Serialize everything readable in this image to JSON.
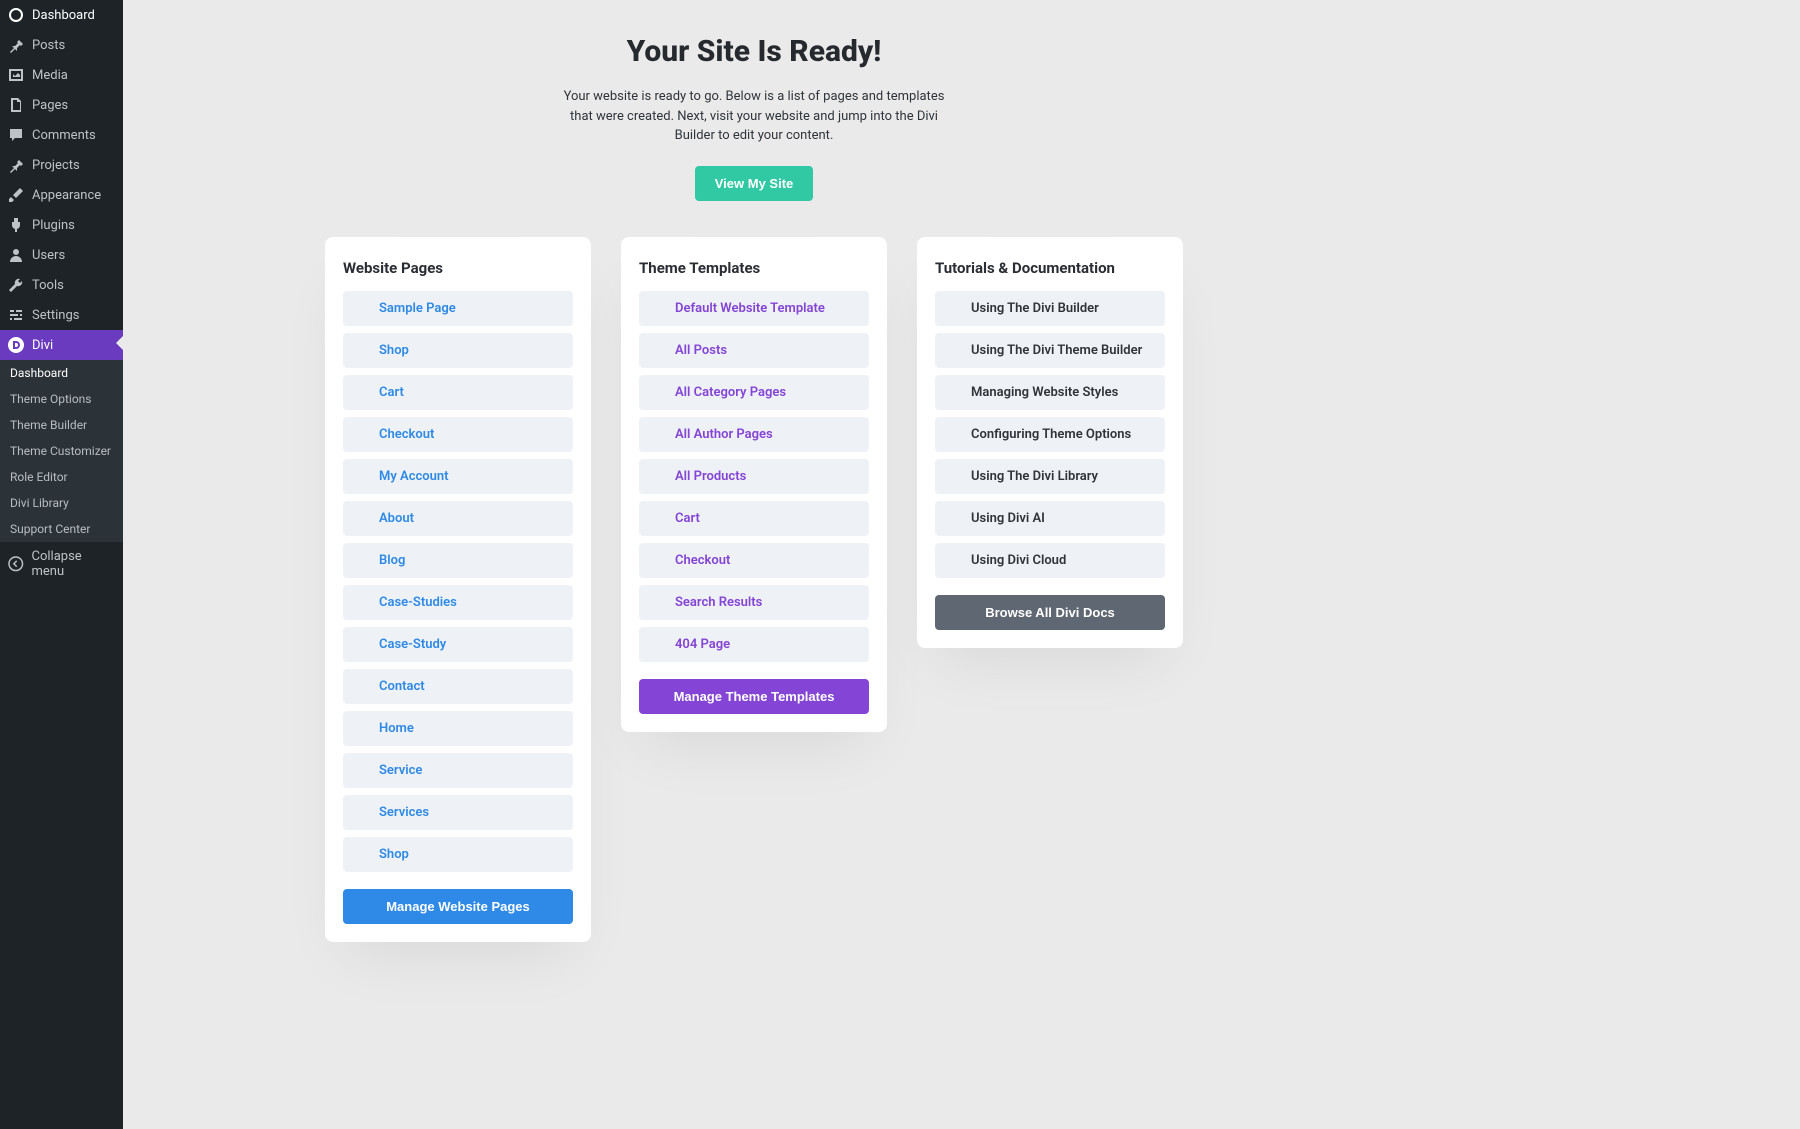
{
  "sidebar": {
    "items": [
      {
        "name": "dashboard",
        "label": "Dashboard",
        "icon": "gauge"
      },
      {
        "name": "posts",
        "label": "Posts",
        "icon": "pin"
      },
      {
        "name": "media",
        "label": "Media",
        "icon": "media"
      },
      {
        "name": "pages",
        "label": "Pages",
        "icon": "pages"
      },
      {
        "name": "comments",
        "label": "Comments",
        "icon": "comment"
      },
      {
        "name": "projects",
        "label": "Projects",
        "icon": "pin"
      },
      {
        "name": "appearance",
        "label": "Appearance",
        "icon": "brush"
      },
      {
        "name": "plugins",
        "label": "Plugins",
        "icon": "plug"
      },
      {
        "name": "users",
        "label": "Users",
        "icon": "user"
      },
      {
        "name": "tools",
        "label": "Tools",
        "icon": "wrench"
      },
      {
        "name": "settings",
        "label": "Settings",
        "icon": "sliders"
      }
    ],
    "active": {
      "name": "divi",
      "label": "Divi",
      "icon": "divi"
    },
    "sub": [
      {
        "label": "Dashboard",
        "active": true
      },
      {
        "label": "Theme Options"
      },
      {
        "label": "Theme Builder"
      },
      {
        "label": "Theme Customizer"
      },
      {
        "label": "Role Editor"
      },
      {
        "label": "Divi Library"
      },
      {
        "label": "Support Center"
      }
    ],
    "collapse": "Collapse menu"
  },
  "hero": {
    "title": "Your Site Is Ready!",
    "body": "Your website is ready to go. Below is a list of pages and templates that were created. Next, visit your website and jump into the Divi Builder to edit your content.",
    "view_btn": "View My Site"
  },
  "cards": {
    "pages": {
      "title": "Website Pages",
      "items": [
        "Sample Page",
        "Shop",
        "Cart",
        "Checkout",
        "My Account",
        "About",
        "Blog",
        "Case-Studies",
        "Case-Study",
        "Contact",
        "Home",
        "Service",
        "Services",
        "Shop"
      ],
      "btn": "Manage Website Pages"
    },
    "templates": {
      "title": "Theme Templates",
      "items": [
        "Default Website Template",
        "All Posts",
        "All Category Pages",
        "All Author Pages",
        "All Products",
        "Cart",
        "Checkout",
        "Search Results",
        "404 Page"
      ],
      "btn": "Manage Theme Templates"
    },
    "docs": {
      "title": "Tutorials & Documentation",
      "items": [
        "Using The Divi Builder",
        "Using The Divi Theme Builder",
        "Managing Website Styles",
        "Configuring Theme Options",
        "Using The Divi Library",
        "Using Divi AI",
        "Using Divi Cloud"
      ],
      "btn": "Browse All Divi Docs"
    }
  }
}
